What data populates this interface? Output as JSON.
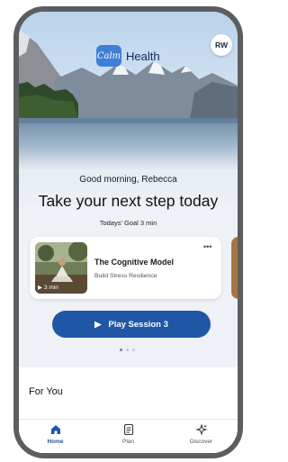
{
  "header": {
    "brand_mark": "Calm",
    "brand_word": "Health",
    "avatar_initials": "RW"
  },
  "greeting": "Good morning, Rebecca",
  "headline": "Take your next step today",
  "goal": "Todays' Goal 3 min",
  "session_card": {
    "title": "The Cognitive Model",
    "subtitle": "Build Stress Resilience",
    "duration": "3 min",
    "more": "•••"
  },
  "play_button": {
    "label": "Play Session 3"
  },
  "carousel": {
    "pages": 3,
    "active": 0
  },
  "for_you": {
    "title": "For You"
  },
  "nav": {
    "items": [
      {
        "label": "Home",
        "icon": "home-icon",
        "active": true
      },
      {
        "label": "Plan",
        "icon": "plan-icon",
        "active": false
      },
      {
        "label": "Discover",
        "icon": "discover-icon",
        "active": false
      }
    ]
  },
  "colors": {
    "accent": "#1f56a6",
    "brand": "#3f7fd8",
    "frame": "#5b5e61"
  }
}
